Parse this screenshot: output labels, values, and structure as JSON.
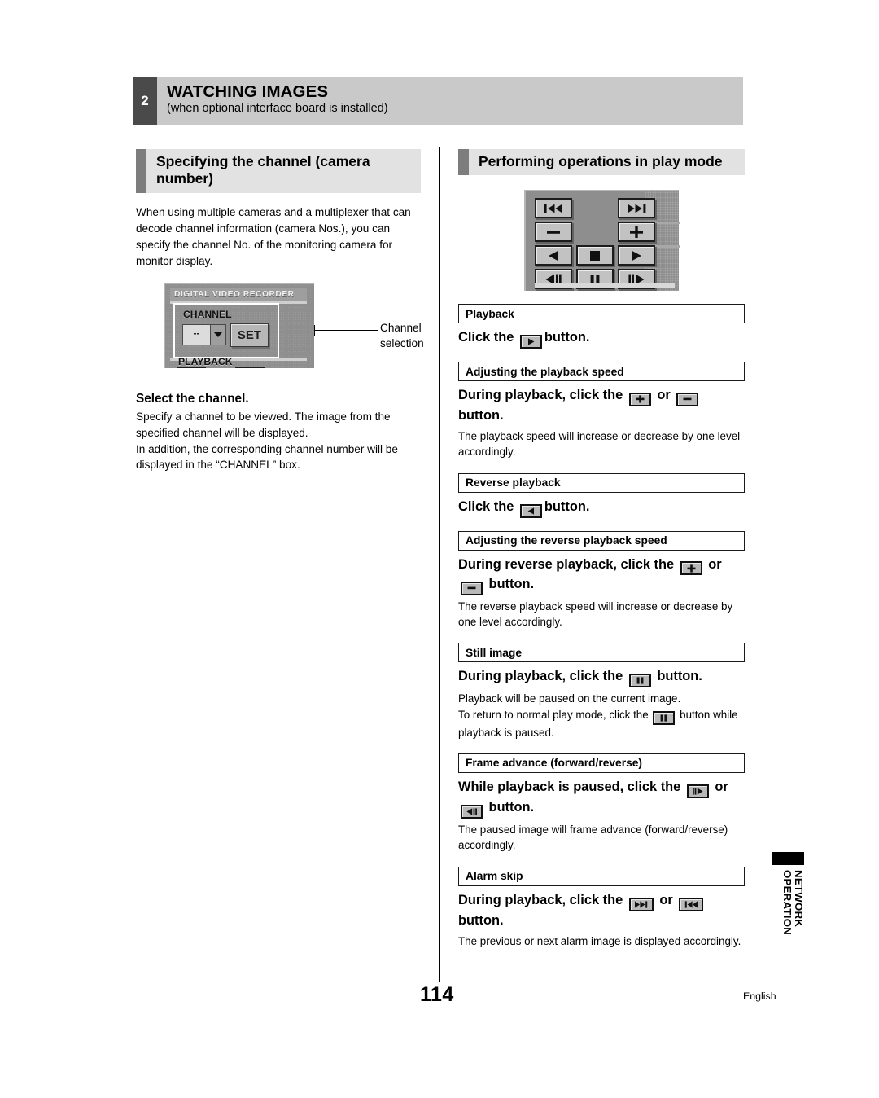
{
  "header": {
    "number": "2",
    "title": "WATCHING IMAGES",
    "subtitle": "(when optional interface board is installed)"
  },
  "left_column": {
    "section_title": "Specifying the channel (camera number)",
    "intro": "When using multiple cameras and a multiplexer that can decode channel information (camera Nos.), you can specify the channel No. of the monitoring camera for monitor display.",
    "dvr_figure": {
      "brand_label": "DIGITAL VIDEO RECORDER",
      "channel_label": "CHANNEL",
      "channel_value": "--",
      "dropdown_icon": "chevron-down-icon",
      "set_button": "SET",
      "playback_label": "PLAYBACK",
      "playback_button_1_icon": "skip-backward-icon",
      "playback_button_2_icon": "skip-forward-icon",
      "callout": "Channel\nselection"
    },
    "subhead": "Select the channel.",
    "body": "Specify a channel to be viewed. The image from the specified channel will be displayed.\nIn addition, the corresponding channel number will be displayed in the “CHANNEL” box."
  },
  "right_column": {
    "section_title": "Performing operations in play mode",
    "control_panel": {
      "buttons": [
        {
          "icon": "skip-backward-icon",
          "row": 1,
          "col": 1
        },
        {
          "icon": "empty",
          "row": 1,
          "col": 2
        },
        {
          "icon": "skip-forward-icon",
          "row": 1,
          "col": 3
        },
        {
          "icon": "minus-icon",
          "row": 2,
          "col": 1
        },
        {
          "icon": "empty",
          "row": 2,
          "col": 2
        },
        {
          "icon": "plus-icon",
          "row": 2,
          "col": 3
        },
        {
          "icon": "reverse-play-icon",
          "row": 3,
          "col": 1
        },
        {
          "icon": "stop-icon",
          "row": 3,
          "col": 2
        },
        {
          "icon": "play-icon",
          "row": 3,
          "col": 3
        },
        {
          "icon": "frame-reverse-icon",
          "row": 4,
          "col": 1
        },
        {
          "icon": "pause-icon",
          "row": 4,
          "col": 2
        },
        {
          "icon": "frame-forward-icon",
          "row": 4,
          "col": 3
        }
      ]
    },
    "blocks": [
      {
        "label": "Playback",
        "instruction_parts": [
          "Click the ",
          "button."
        ],
        "instruction_icons": [
          "play-icon"
        ],
        "note": ""
      },
      {
        "label": "Adjusting the playback speed",
        "instruction_parts": [
          "During playback, click the ",
          " or ",
          " button."
        ],
        "instruction_icons": [
          "plus-icon",
          "minus-icon"
        ],
        "note": "The playback speed will increase or decrease by one level accordingly."
      },
      {
        "label": "Reverse playback",
        "instruction_parts": [
          "Click the ",
          "button."
        ],
        "instruction_icons": [
          "reverse-play-icon"
        ],
        "note": ""
      },
      {
        "label": "Adjusting the reverse playback speed",
        "instruction_parts": [
          "During reverse playback, click the ",
          " or ",
          " button."
        ],
        "instruction_icons": [
          "plus-icon",
          "minus-icon"
        ],
        "note": "The reverse playback speed will increase or decrease by one level accordingly."
      },
      {
        "label": "Still image",
        "instruction_parts": [
          "During playback, click the ",
          " button."
        ],
        "instruction_icons": [
          "pause-icon"
        ],
        "note": "Playback will be paused on the current image.\nTo return to normal play mode, click the @ button while playback is paused.",
        "note_icons": [
          "pause-icon"
        ]
      },
      {
        "label": "Frame advance (forward/reverse)",
        "instruction_parts": [
          "While playback is paused, click the ",
          " or ",
          " button."
        ],
        "instruction_icons": [
          "frame-forward-icon",
          "frame-reverse-icon"
        ],
        "note": "The paused image will frame advance (forward/reverse) accordingly."
      },
      {
        "label": "Alarm skip",
        "instruction_parts": [
          "During playback, click the ",
          " or ",
          " button."
        ],
        "instruction_icons": [
          "skip-forward-icon",
          "skip-backward-icon"
        ],
        "note": "The previous or next alarm image is displayed accordingly."
      }
    ]
  },
  "thumb_tab": {
    "text": "NETWORK\nOPERATION"
  },
  "footer": {
    "page_number": "114",
    "language": "English"
  },
  "colors": {
    "header_bar": "#c9c9c9",
    "chapter_badge": "#4a4a4a",
    "section_bar": "#e2e2e2",
    "section_tab": "#7d7d7d",
    "device_body": "#8e8e8e"
  }
}
